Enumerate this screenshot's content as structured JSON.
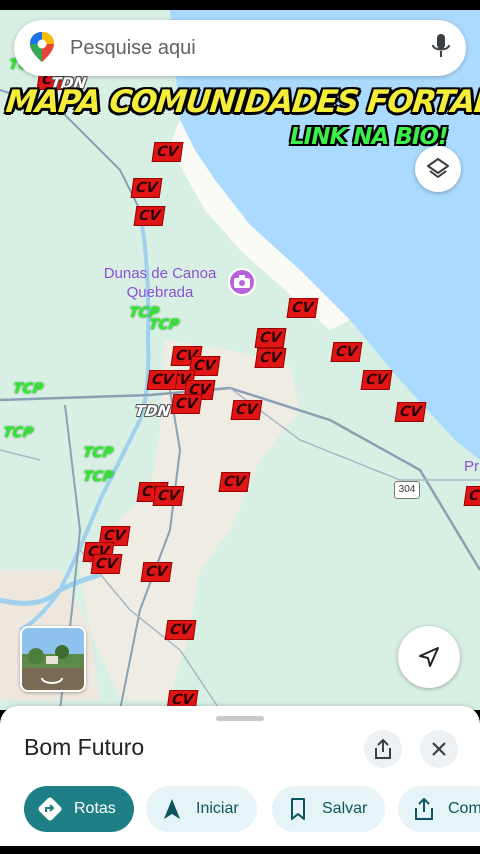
{
  "search": {
    "placeholder": "Pesquise aqui",
    "icon_left": "maps-pin-icon",
    "icon_right": "mic-icon"
  },
  "overlay": {
    "headline": "MAPA COMUNIDADES FORTALEZA(CE)",
    "subline": "LINK NA BIO!"
  },
  "map": {
    "poi": {
      "name": "Dunas de Canoa Quebrada",
      "icon": "camera-icon"
    },
    "edge_label": "Pr",
    "road_badge": "304",
    "tag_labels": {
      "cv": "CV",
      "tcp": "TCP",
      "tdn": "TDN"
    },
    "colors": {
      "cv": "#e01515",
      "tcp": "#2dea2d",
      "sea": "#aadaff",
      "land": "#d8efe3",
      "poi": "#8e4fd3"
    }
  },
  "controls": {
    "layers": "layers-icon",
    "navigate": "navigation-arrow-icon",
    "street_view": "street-view-thumbnail"
  },
  "sheet": {
    "title": "Bom Futuro",
    "actions": [
      {
        "label": "Rotas",
        "icon": "directions-icon"
      },
      {
        "label": "Iniciar",
        "icon": "navigation-icon"
      },
      {
        "label": "Salvar",
        "icon": "bookmark-icon"
      },
      {
        "label": "Com",
        "icon": "share-icon"
      }
    ]
  }
}
